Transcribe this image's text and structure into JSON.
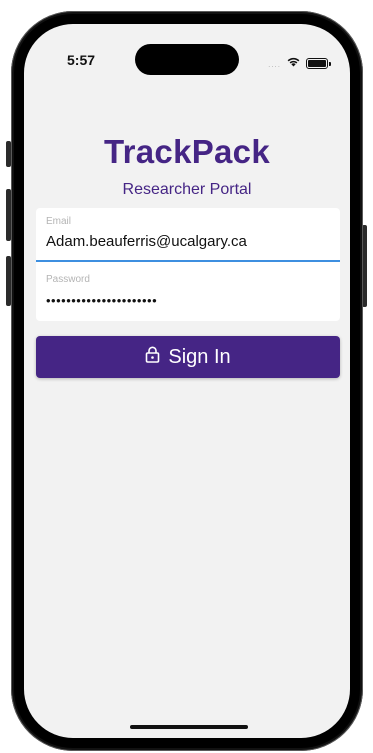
{
  "status_bar": {
    "time": "5:57",
    "signal": "....",
    "icons": [
      "wifi-icon",
      "battery-icon"
    ]
  },
  "app": {
    "title": "TrackPack",
    "subtitle": "Researcher Portal"
  },
  "form": {
    "email_label": "Email",
    "email_value": "Adam.beauferris@ucalgary.ca",
    "password_label": "Password",
    "password_value": "••••••••••••••••••••••"
  },
  "signin_button": {
    "label": "Sign In",
    "icon": "lock-icon"
  },
  "colors": {
    "brand": "#452585",
    "focus": "#3d8fe0",
    "background": "#f2f2f2"
  }
}
